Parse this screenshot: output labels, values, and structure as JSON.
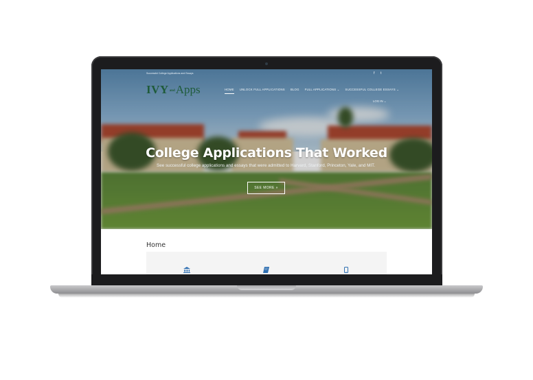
{
  "site": {
    "tagline": "Successful College Applications and Essays",
    "social": [
      "f",
      "t"
    ],
    "logo": {
      "ivy": "IVY",
      "and": "and",
      "apps": "Apps"
    },
    "nav": [
      {
        "label": "HOME",
        "active": true
      },
      {
        "label": "UNLOCK FULL APPLICATIONS"
      },
      {
        "label": "BLOG"
      },
      {
        "label": "FULL APPLICATIONS ⌄"
      },
      {
        "label": "SUCCESSFUL COLLEGE ESSAYS ⌄"
      }
    ],
    "login": "LOG IN ⌄"
  },
  "hero": {
    "headline": "College Applications That Worked",
    "subline": "See successful college applications and essays that were admitted to Harvard, Stanford, Princeton, Yale, and MIT.",
    "cta": "SEE MORE »"
  },
  "content": {
    "title": "Home",
    "feature_icons": [
      "institution-icon",
      "book-icon",
      "mobile-icon"
    ]
  },
  "colors": {
    "logo_green": "#1f5b3a",
    "icon_blue": "#2f6fb1",
    "laptop_bezel": "#1c1c1e"
  }
}
